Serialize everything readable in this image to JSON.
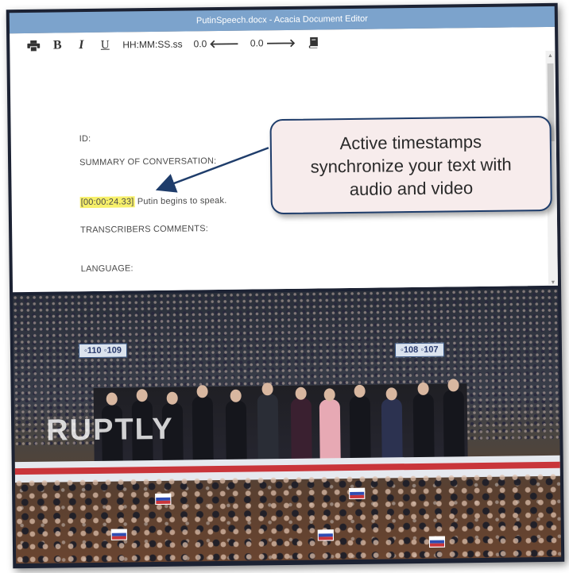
{
  "window": {
    "title": "PutinSpeech.docx - Acacia Document Editor"
  },
  "toolbar": {
    "print_icon": "printer-icon",
    "bold_label": "B",
    "italic_label": "I",
    "underline_label": "U",
    "timestamp_format": "HH:MM:SS.ss",
    "rewind_value": "0.0",
    "forward_value": "0.0",
    "notes_icon": "book-icon"
  },
  "document": {
    "id_label": "ID:",
    "summary_label": "SUMMARY OF CONVERSATION:",
    "timestamp": "[00:00:24.33]",
    "timestamp_text": " Putin begins to speak.",
    "transcriber_label": "TRANSCRIBERS COMMENTS:",
    "language_label": "LANGUAGE:"
  },
  "callout": {
    "line1": "Active timestamps",
    "line2": "synchronize your text with",
    "line3": "audio and video"
  },
  "video": {
    "watermark": "RUPTLY",
    "banner_left": "◦110 ◦109",
    "banner_right": "◦108 ◦107"
  },
  "colors": {
    "titlebar": "#7ca3cc",
    "timestamp_highlight": "#f7f06a",
    "callout_border": "#1f3d6b",
    "callout_bg": "#f7ecec"
  }
}
